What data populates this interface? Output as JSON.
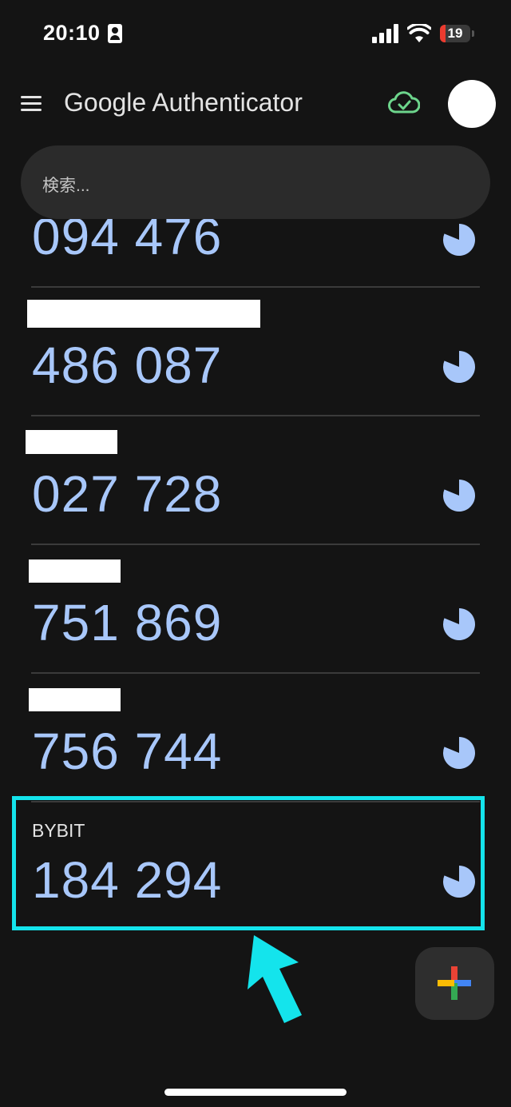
{
  "status_bar": {
    "time": "20:10",
    "battery": "19"
  },
  "app_bar": {
    "title_brand": "Google",
    "title_product": " Authenticator"
  },
  "search": {
    "placeholder": "検索..."
  },
  "accounts": [
    {
      "name": "",
      "code": "094 476"
    },
    {
      "name": "",
      "code": "486 087"
    },
    {
      "name": "",
      "code": "027 728"
    },
    {
      "name": "",
      "code": "751 869"
    },
    {
      "name": "",
      "code": "756 744"
    },
    {
      "name": "BYBIT",
      "code": "184 294"
    }
  ],
  "colors": {
    "background": "#141414",
    "code": "#a8c7fa",
    "highlight": "#14e4ec",
    "sync_ok": "#6dd58c"
  },
  "icons": {
    "menu": "hamburger-menu-icon",
    "sync": "cloud-check-icon",
    "timer": "countdown-pie-icon",
    "add": "google-plus-icon"
  }
}
